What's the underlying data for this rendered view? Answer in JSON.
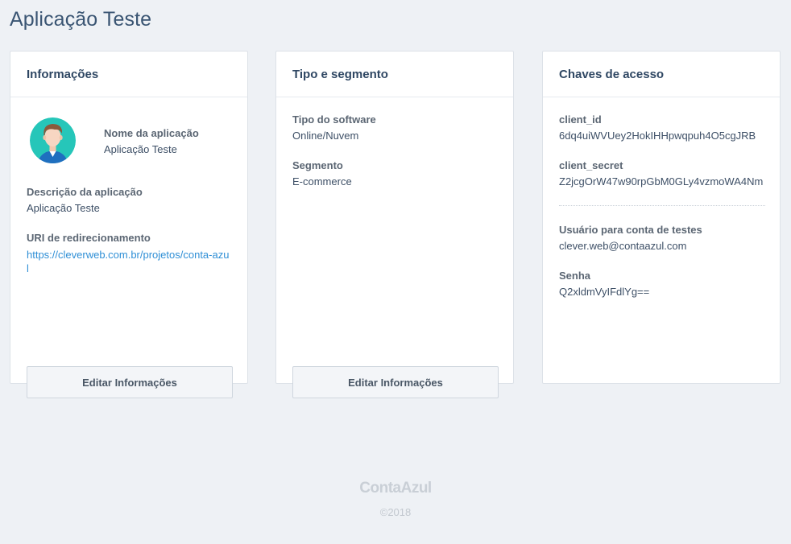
{
  "page": {
    "title": "Aplicação Teste"
  },
  "info_card": {
    "title": "Informações",
    "app_name_label": "Nome da aplicação",
    "app_name_value": "Aplicação Teste",
    "description_label": "Descrição da aplicação",
    "description_value": "Aplicação Teste",
    "redirect_label": "URI de redirecionamento",
    "redirect_value": "https://cleverweb.com.br/projetos/conta-azul",
    "edit_label": "Editar Informações"
  },
  "segment_card": {
    "title": "Tipo e segmento",
    "software_label": "Tipo do software",
    "software_value": "Online/Nuvem",
    "segment_label": "Segmento",
    "segment_value": "E-commerce",
    "edit_label": "Editar Informações"
  },
  "keys_card": {
    "title": "Chaves de acesso",
    "client_id_label": "client_id",
    "client_id_value": "6dq4uiWVUey2HokIHHpwqpuh4O5cgJRB",
    "client_secret_label": "client_secret",
    "client_secret_value": "Z2jcgOrW47w90rpGbM0GLy4vzmoWA4Nm",
    "test_user_label": "Usuário para conta de testes",
    "test_user_value": "clever.web@contaazul.com",
    "password_label": "Senha",
    "password_value": "Q2xldmVyIFdlYg=="
  },
  "footer": {
    "logo": "ContaAzul",
    "copyright": "©2018"
  },
  "icons": {
    "avatar": "user-avatar-icon"
  },
  "colors": {
    "accent": "#2f8fd6",
    "title": "#3a5573",
    "avatar_bg": "#26c6b9"
  }
}
